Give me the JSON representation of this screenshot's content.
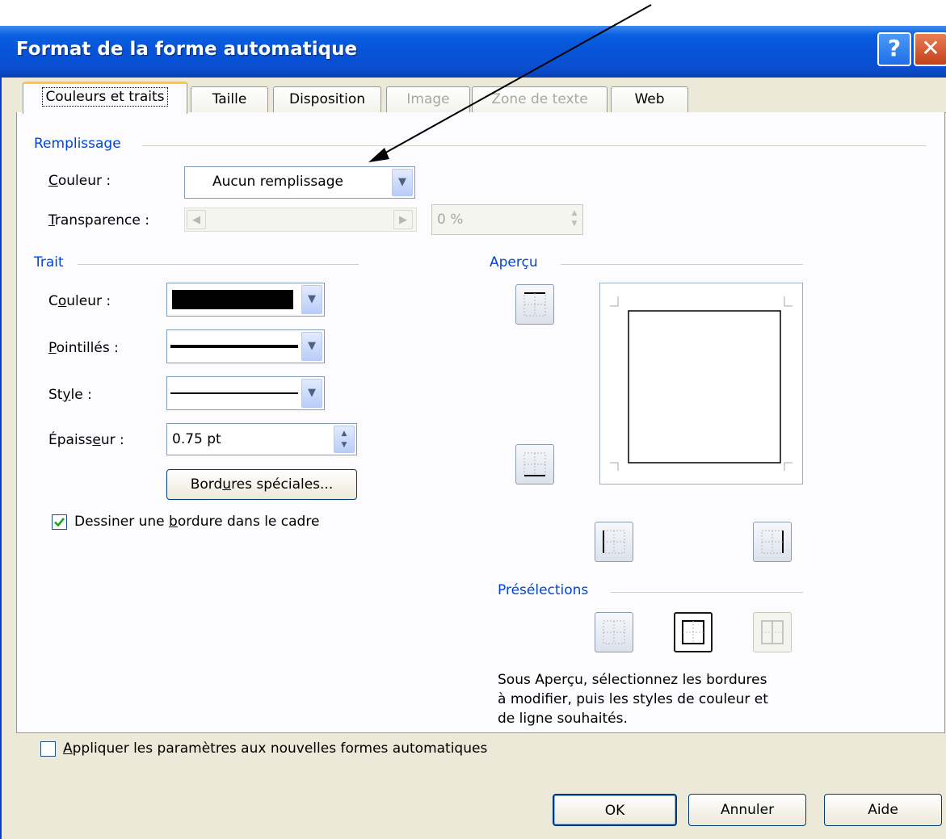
{
  "window": {
    "title": "Format de la forme automatique",
    "help_label": "?",
    "close_label": "✕"
  },
  "tabs": [
    {
      "label": "Couleurs et traits",
      "state": "active"
    },
    {
      "label": "Taille",
      "state": "normal"
    },
    {
      "label": "Disposition",
      "state": "normal"
    },
    {
      "label": "Image",
      "state": "disabled"
    },
    {
      "label": "Zone de texte",
      "state": "disabled"
    },
    {
      "label": "Web",
      "state": "normal"
    }
  ],
  "fill": {
    "group_label": "Remplissage",
    "color_label": "Couleur :",
    "color_value": "Aucun remplissage",
    "transparency_label": "Transparence :",
    "transparency_value": "0 %"
  },
  "line": {
    "group_label": "Trait",
    "color_label": "Couleur :",
    "dash_label": "Pointillés :",
    "style_label": "Style :",
    "weight_label": "Épaisseur :",
    "weight_value": "0.75 pt",
    "special_borders_label": "Bordures spéciales...",
    "draw_border_label": "Dessiner une bordure dans le cadre",
    "draw_border_checked": true,
    "color_swatch": "#000000"
  },
  "preview": {
    "group_label": "Aperçu"
  },
  "presets": {
    "group_label": "Présélections",
    "help_text_lines": [
      "Sous Aperçu, sélectionnez les bordures",
      "à modifier, puis les styles de couleur et",
      "de ligne souhaités."
    ]
  },
  "apply_defaults": {
    "label": "Appliquer les paramètres aux nouvelles formes automatiques",
    "checked": false
  },
  "buttons": {
    "ok": "OK",
    "cancel": "Annuler",
    "help": "Aide"
  },
  "colors": {
    "title_bar": "#0753d8",
    "group_label": "#0046d5",
    "dialog_bg": "#ece9d8",
    "tab_highlight": "#ffc83c"
  }
}
